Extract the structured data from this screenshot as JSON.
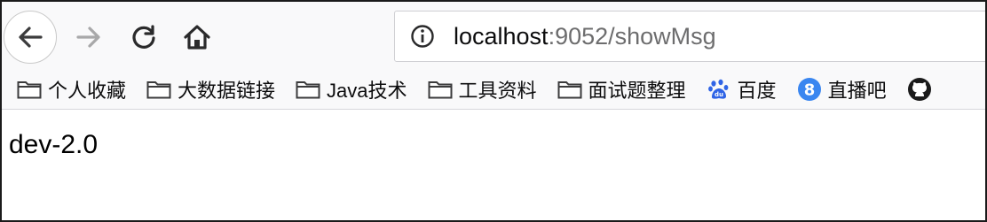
{
  "toolbar": {
    "back_icon": "arrow-left-icon",
    "forward_icon": "arrow-right-icon",
    "reload_icon": "reload-icon",
    "home_icon": "home-icon"
  },
  "urlbar": {
    "info_icon": "info-icon",
    "host": "localhost",
    "rest": ":9052/showMsg"
  },
  "bookmarks": [
    {
      "label": "个人收藏",
      "icon": "folder-icon"
    },
    {
      "label": "大数据链接",
      "icon": "folder-icon"
    },
    {
      "label": "Java技术",
      "icon": "folder-icon"
    },
    {
      "label": "工具资料",
      "icon": "folder-icon"
    },
    {
      "label": "面试题整理",
      "icon": "folder-icon"
    },
    {
      "label": "百度",
      "icon": "baidu-paw-icon"
    },
    {
      "label": "直播吧",
      "icon": "zhibo8-icon"
    },
    {
      "label": "",
      "icon": "github-icon"
    }
  ],
  "colors": {
    "toolbar_bg": "#f9f9fa",
    "url_host": "#0c0c0d",
    "url_path": "#6d6d6e",
    "baidu_blue": "#2f64e6",
    "zhibo8_blue": "#3a86f0"
  },
  "content": {
    "text": "dev-2.0"
  }
}
